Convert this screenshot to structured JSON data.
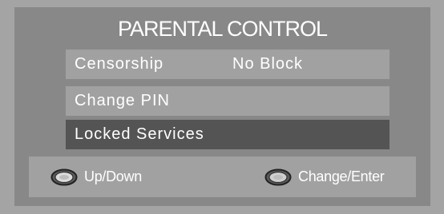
{
  "title": "PARENTAL CONTROL",
  "menu": {
    "items": [
      {
        "label": "Censorship",
        "value": "No Block",
        "selected": false
      },
      {
        "label": "Change PIN",
        "value": "",
        "selected": false
      },
      {
        "label": "Locked Services",
        "value": "",
        "selected": true
      }
    ]
  },
  "footer": {
    "hints": [
      {
        "icon": "up-down-button-icon",
        "label": "Up/Down"
      },
      {
        "icon": "ok-button-icon",
        "label": "Change/Enter"
      }
    ]
  },
  "colors": {
    "background": "#a4a4a4",
    "panel": "#888888",
    "item": "#a1a1a1",
    "item_selected": "#545454",
    "text": "#ffffff"
  }
}
